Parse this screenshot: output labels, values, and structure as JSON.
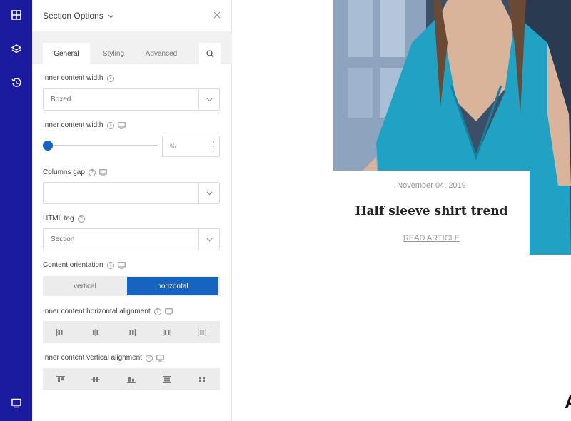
{
  "toolbar": {
    "icons": [
      "add-widget-icon",
      "layers-icon",
      "history-icon",
      "responsive-preview-icon"
    ],
    "color": "#1a1b9e"
  },
  "panel": {
    "title": "Section Options",
    "tabs": [
      {
        "label": "General",
        "active": true
      },
      {
        "label": "Styling",
        "active": false
      },
      {
        "label": "Advanced",
        "active": false
      }
    ],
    "fields": {
      "inner_width": {
        "label": "Inner content width",
        "value": "Boxed"
      },
      "inner_width_slider": {
        "label": "Inner content width",
        "unit": "%",
        "level": 0
      },
      "columns_gap": {
        "label": "Columns gap",
        "value": ""
      },
      "html_tag": {
        "label": "HTML tag",
        "value": "Section"
      },
      "orientation": {
        "label": "Content orientation",
        "options": [
          "vertical",
          "horizontal"
        ],
        "selected": "horizontal"
      },
      "h_align": {
        "label": "Inner content horizontal alignment"
      },
      "v_align": {
        "label": "Inner content vertical alignment"
      }
    },
    "accent": "#1565c0"
  },
  "preview": {
    "date": "November 04, 2019",
    "title": "Half sleeve shirt trend",
    "link": "READ ARTICLE",
    "corner_glyph": "A"
  }
}
